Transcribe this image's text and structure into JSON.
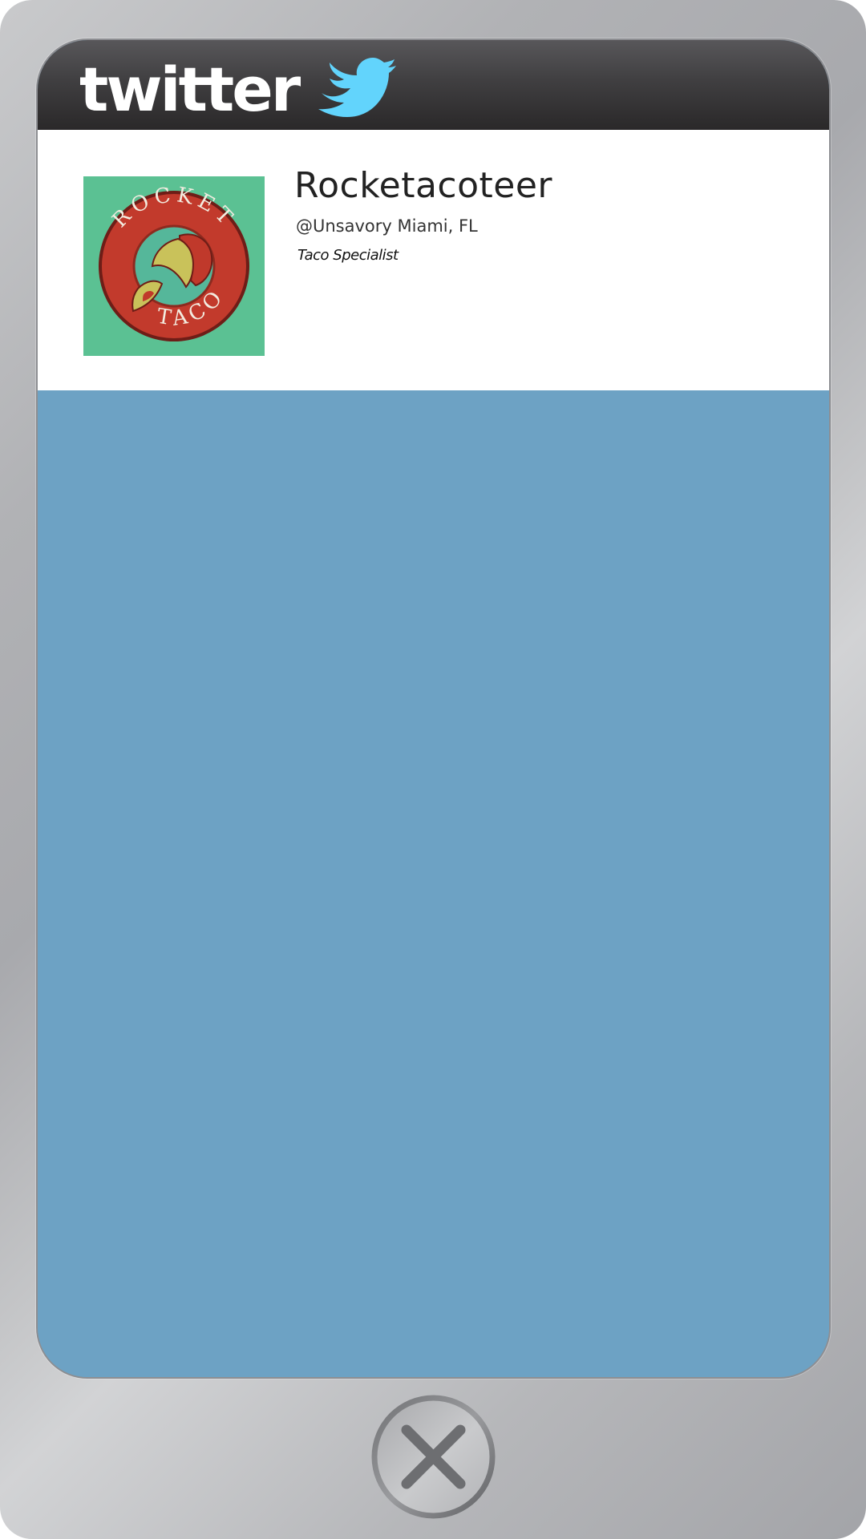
{
  "header": {
    "logo_text": "twitter",
    "logo_icon": "twitter-bird-icon",
    "bird_color": "#62d4fc"
  },
  "profile": {
    "name": "Rocketacoteer",
    "handle_location": "@Unsavory Miami, FL",
    "bio": "Taco Specialist",
    "avatar": {
      "top_text": "ROCKET",
      "bottom_text": "TACO",
      "background": "#5bc193",
      "ring_color": "#c23a2c"
    }
  },
  "feed": {
    "background": "#6da2c4"
  },
  "controls": {
    "close_icon": "close-icon"
  }
}
